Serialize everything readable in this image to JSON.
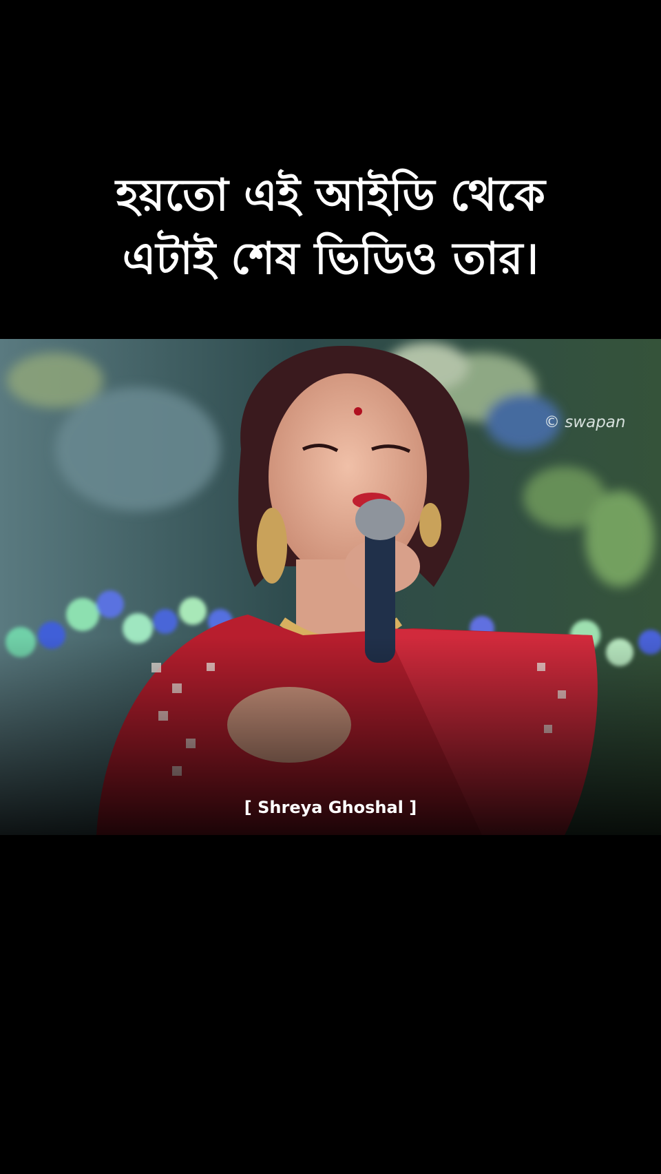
{
  "caption": {
    "line1": "হয়তো এই আইডি থেকে",
    "line2": "এটাই শেষ ভিডিও তার।"
  },
  "video": {
    "watermark": "© swapan",
    "credit": "[ Shreya Ghoshal ]"
  },
  "colors": {
    "background": "#000000",
    "caption_text": "#ffffff",
    "saree_red": "#b81e2e"
  }
}
